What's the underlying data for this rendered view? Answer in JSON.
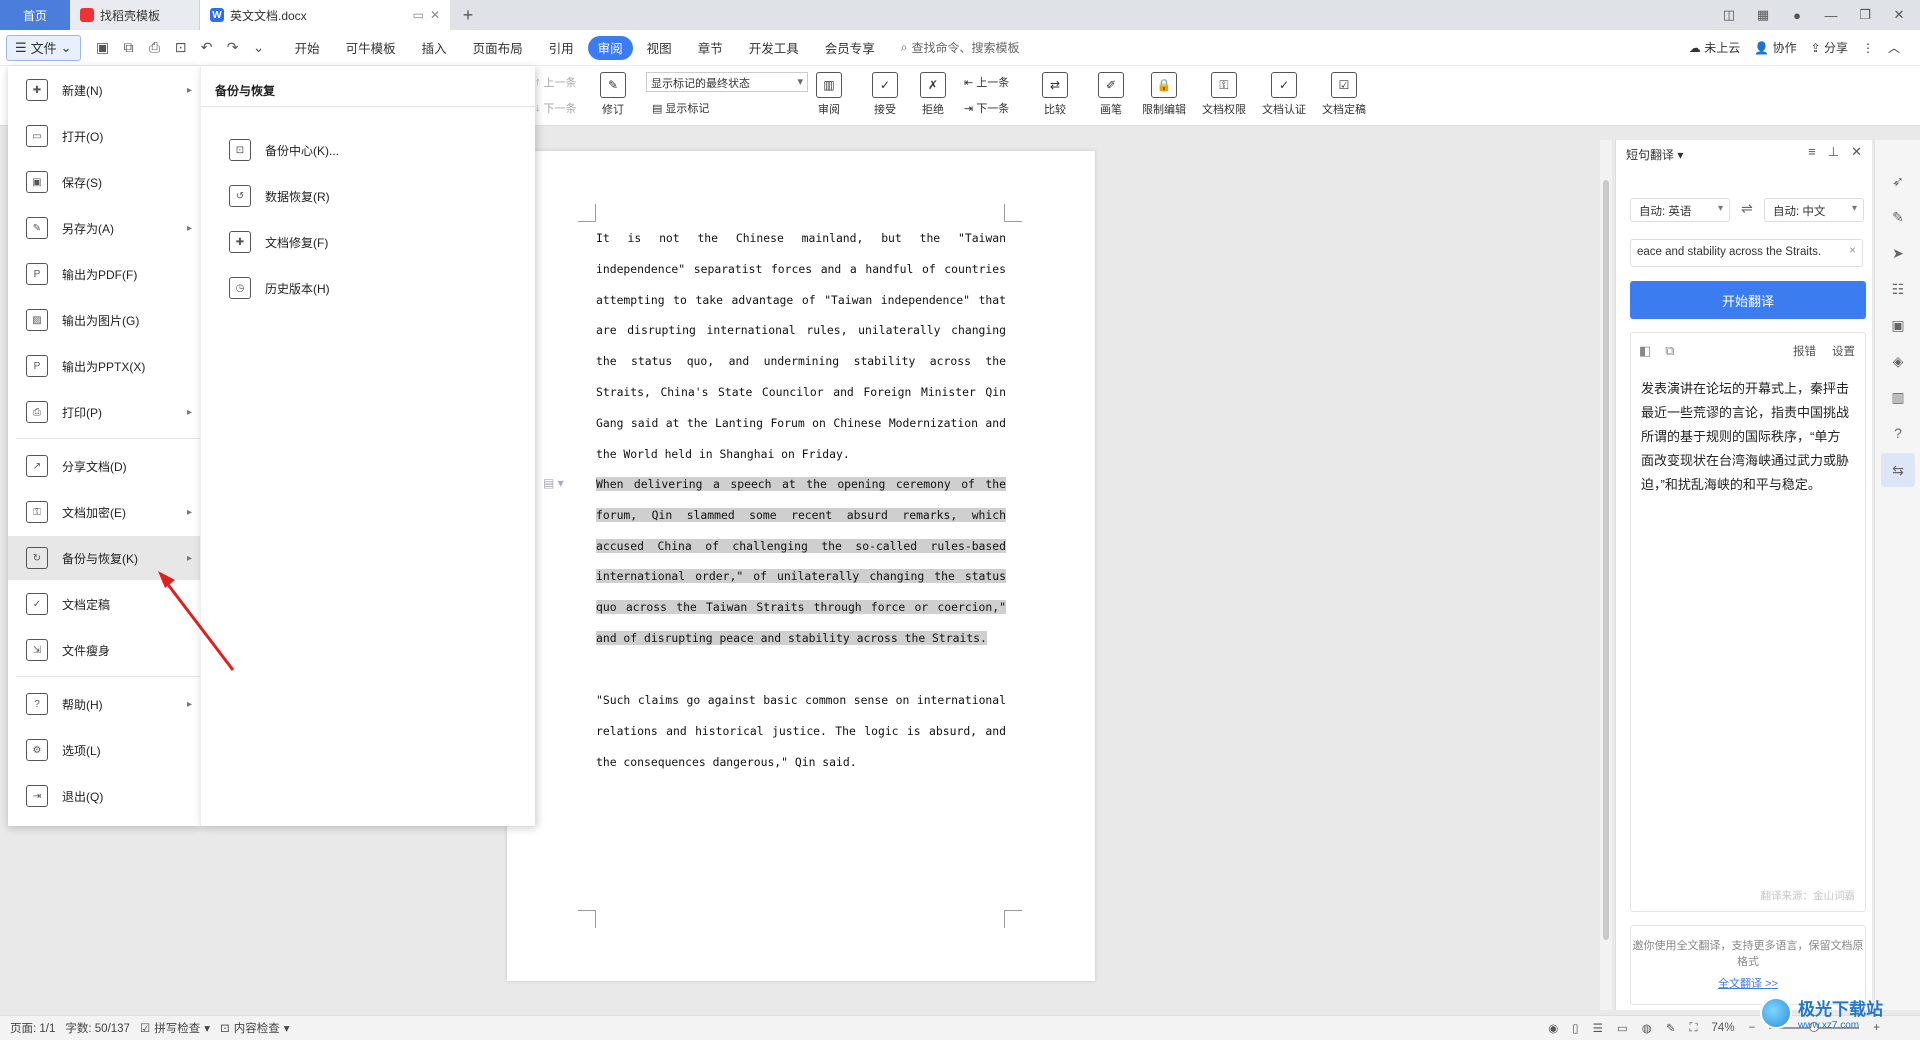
{
  "titlebar": {
    "tabs": [
      {
        "label": "首页"
      },
      {
        "label": "找稻壳模板"
      },
      {
        "label": "英文文档.docx"
      }
    ],
    "plus": "+"
  },
  "menurow": {
    "file_label": "文件",
    "tabs": [
      "开始",
      "可牛模板",
      "插入",
      "页面布局",
      "引用",
      "审阅",
      "视图",
      "章节",
      "开发工具",
      "会员专享"
    ],
    "active_tab": "审阅",
    "search_placeholder": "查找命令、搜索模板",
    "right": {
      "cloud": "未上云",
      "collab": "协作",
      "share": "分享"
    }
  },
  "ribbon": {
    "prev": "上一条",
    "next": "下一条",
    "revise": "修订",
    "state_select": "显示标记的最终状态",
    "show_marks": "显示标记",
    "review": "审阅",
    "accept": "接受",
    "reject": "拒绝",
    "prev2": "上一条",
    "next2": "下一条",
    "compare": "比较",
    "ink": "画笔",
    "restrict": "限制编辑",
    "perm": "文档权限",
    "cert": "文档认证",
    "finalize": "文档定稿"
  },
  "document": {
    "para1": "It is not the Chinese mainland, but the \"Taiwan independence\" separatist forces and a handful of countries attempting to take advantage of \"Taiwan independence\" that are disrupting international rules, unilaterally changing the status quo, and undermining stability across the Straits, China's State Councilor and Foreign Minister Qin Gang said at the Lanting Forum on Chinese Modernization and the World held in Shanghai on Friday.",
    "para2": "When delivering a speech at the opening ceremony of the forum, Qin slammed some recent absurd remarks, which accused China of challenging the so-called rules-based international order,\" of unilaterally changing the status quo across the Taiwan Straits through force or coercion,\" and of disrupting peace and stability across the Straits.",
    "para3": "\"Such claims go against basic common sense on international relations and historical justice. The logic is absurd, and the consequences dangerous,\" Qin said."
  },
  "translate": {
    "title": "短句翻译",
    "src_lang": "自动: 英语",
    "dst_lang": "自动: 中文",
    "input_value": "eace and stability across the Straits.",
    "start_button": "开始翻译",
    "report": "报错",
    "settings": "设置",
    "result": "发表演讲在论坛的开幕式上，秦抨击最近一些荒谬的言论，指责中国挑战所谓的基于规则的国际秩序，“单方面改变现状在台湾海峡通过武力或胁迫，”和扰乱海峡的和平与稳定。",
    "source": "翻译来源：金山词霸",
    "promo": "邀你使用全文翻译，支持更多语言，保留文档原格式",
    "promo_link": "全文翻译 >>"
  },
  "filemenu": {
    "items": [
      {
        "label": "新建(N)",
        "arrow": true
      },
      {
        "label": "打开(O)",
        "arrow": false
      },
      {
        "label": "保存(S)",
        "arrow": false
      },
      {
        "label": "另存为(A)",
        "arrow": true
      },
      {
        "label": "输出为PDF(F)",
        "arrow": false
      },
      {
        "label": "输出为图片(G)",
        "arrow": false
      },
      {
        "label": "输出为PPTX(X)",
        "arrow": false
      },
      {
        "label": "打印(P)",
        "arrow": true
      },
      {
        "label": "分享文档(D)",
        "arrow": false
      },
      {
        "label": "文档加密(E)",
        "arrow": true
      },
      {
        "label": "备份与恢复(K)",
        "arrow": true
      },
      {
        "label": "文档定稿",
        "arrow": false
      },
      {
        "label": "文件瘦身",
        "arrow": false
      },
      {
        "label": "帮助(H)",
        "arrow": true
      },
      {
        "label": "选项(L)",
        "arrow": false
      },
      {
        "label": "退出(Q)",
        "arrow": false
      }
    ],
    "active": "备份与恢复(K)"
  },
  "submenu": {
    "title": "备份与恢复",
    "items": [
      {
        "label": "备份中心(K)..."
      },
      {
        "label": "数据恢复(R)"
      },
      {
        "label": "文档修复(F)"
      },
      {
        "label": "历史版本(H)"
      }
    ]
  },
  "statusbar": {
    "page": "页面: 1/1",
    "words": "字数: 50/137",
    "spell": "拼写检查",
    "content": "内容检查",
    "zoom": "74%"
  },
  "watermark": {
    "line1": "极光下载站",
    "line2": "www.xz7.com"
  },
  "colors": {
    "accent": "#3b7cf0",
    "annotation": "#e02020"
  }
}
